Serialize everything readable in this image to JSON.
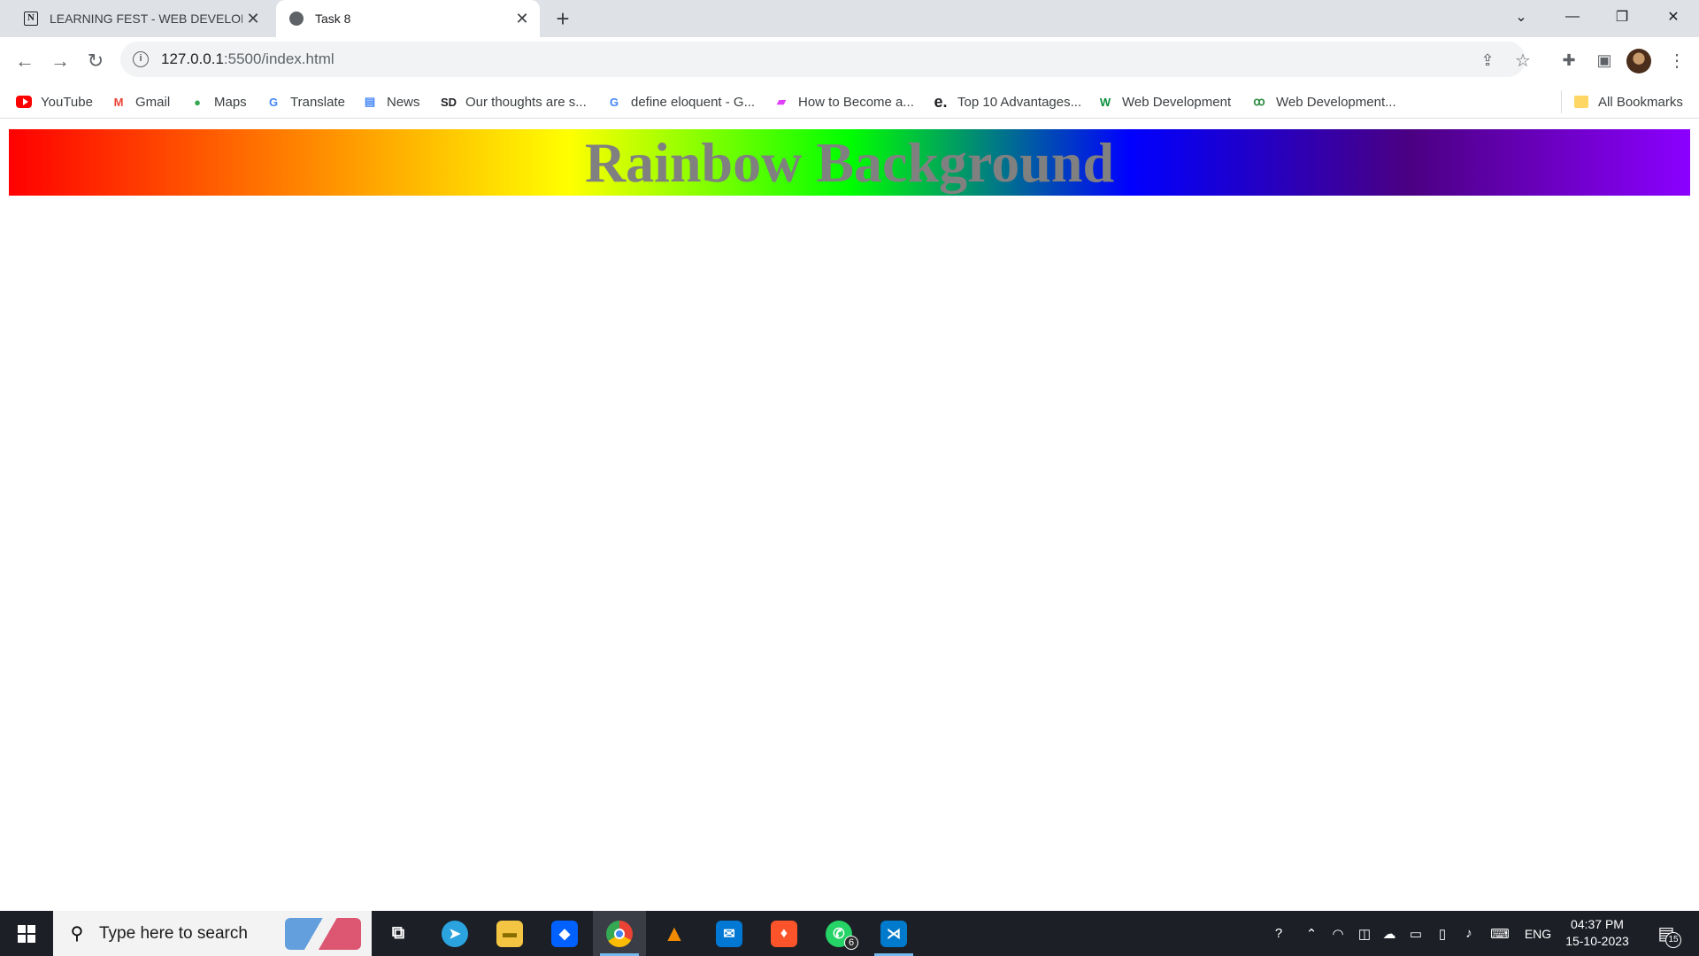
{
  "browser": {
    "tabs": [
      {
        "title": "LEARNING FEST - WEB DEVELOPMENT",
        "favicon": "notion-icon",
        "active": false
      },
      {
        "title": "Task 8",
        "favicon": "globe-icon",
        "active": true
      }
    ],
    "new_tab_label": "+",
    "window_controls": {
      "tab_search": "⌄",
      "minimize": "—",
      "restore": "❐",
      "close": "✕"
    },
    "url_host": "127.0.0.1",
    "url_rest": ":5500/index.html",
    "bookmarks": [
      {
        "label": "YouTube",
        "icon": "youtube-icon"
      },
      {
        "label": "Gmail",
        "icon": "gmail-icon"
      },
      {
        "label": "Maps",
        "icon": "maps-icon"
      },
      {
        "label": "Translate",
        "icon": "translate-icon"
      },
      {
        "label": "News",
        "icon": "news-icon"
      },
      {
        "label": "Our thoughts are s...",
        "icon": "sd-icon"
      },
      {
        "label": "define eloquent - G...",
        "icon": "google-icon"
      },
      {
        "label": "How to Become a...",
        "icon": "site-icon"
      },
      {
        "label": "Top 10 Advantages...",
        "icon": "e-icon"
      },
      {
        "label": "Web Development",
        "icon": "w-icon"
      },
      {
        "label": "Web Development...",
        "icon": "gfg-icon"
      }
    ],
    "all_bookmarks_label": "All Bookmarks"
  },
  "page": {
    "heading": "Rainbow Background",
    "heading_color": "#808080",
    "gradient_colors": [
      "#ff0000",
      "#ff7f00",
      "#ffff00",
      "#00ff00",
      "#0000ff",
      "#4b0082",
      "#8b00ff"
    ]
  },
  "taskbar": {
    "search_placeholder": "Type here to search",
    "apps": [
      "task-view",
      "telegram",
      "file-explorer",
      "dropbox",
      "chrome",
      "vlc",
      "mail",
      "brave",
      "whatsapp",
      "vscode"
    ],
    "whatsapp_badge": "6",
    "language": "ENG",
    "time": "04:37 PM",
    "date": "15-10-2023",
    "notification_count": "15"
  }
}
